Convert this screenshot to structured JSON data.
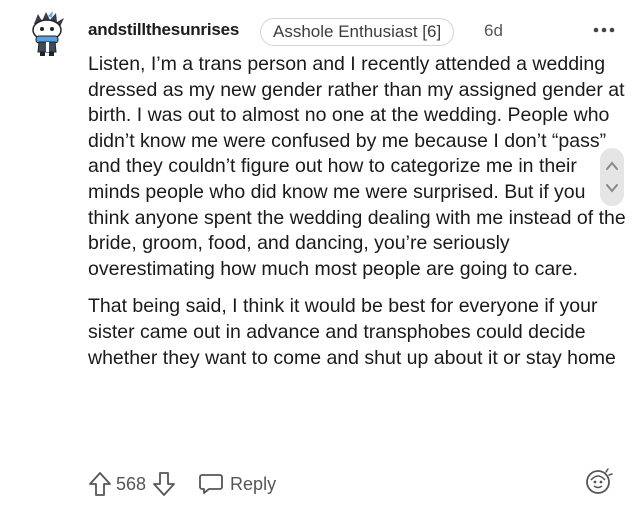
{
  "comment": {
    "username": "andstillthesunrises",
    "flair": "Asshole Enthusiast [6]",
    "age": "6d",
    "paragraphs": [
      "Listen, I’m a trans person and I recently attended a wedding dressed as my new gender rather than my assigned gender at birth. I was out to almost no one at the wedding. People who didn’t know me were confused by me because I don’t “pass” and they couldn’t figure out how to categorize me in their minds people who did know me were surprised. But if you think anyone spent the wedding dealing with me instead of the bride, groom, food, and dancing, you’re seriously overestimating how much most people are going to care.",
      "That being said, I think it would be best for everyone if your sister came out in advance and transphobes could decide whether they want to come and shut up about it or stay home"
    ]
  },
  "actions": {
    "score": "568",
    "reply_label": "Reply"
  },
  "icons": {
    "more": "more-options-icon",
    "upvote": "upvote-arrow-icon",
    "downvote": "downvote-arrow-icon",
    "reply": "speech-bubble-icon",
    "award": "award-icon",
    "scroll": "scroll-handle-icon"
  }
}
